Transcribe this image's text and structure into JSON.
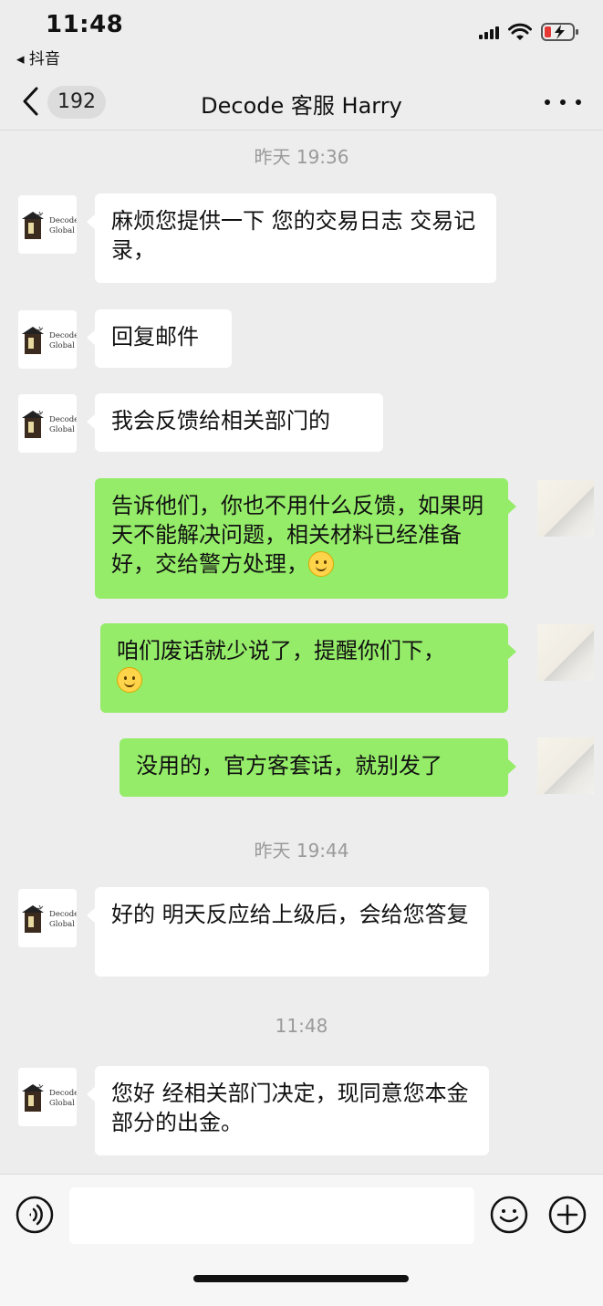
{
  "status_bar": {
    "time": "11:48",
    "back_app": "◂ 抖音"
  },
  "header": {
    "unread_count": "192",
    "title": "Decode 客服 Harry"
  },
  "avatar_text": {
    "line1": "Decode",
    "line2": "Global"
  },
  "chat": {
    "ts1": "昨天 19:36",
    "m1": "麻烦您提供一下 您的交易日志 交易记录，",
    "m2": "回复邮件",
    "m3": "我会反馈给相关部门的",
    "m4": "告诉他们，你也不用什么反馈，如果明天不能解决问题，相关材料已经准备好，交给警方处理，",
    "m5": "咱们废话就少说了，提醒你们下，",
    "m6": "没用的，官方客套话，就别发了",
    "ts2": "昨天 19:44",
    "m7": "好的 明天反应给上级后，会给您答复",
    "ts3": "11:48",
    "m8": "您好 经相关部门决定，现同意您本金部分的出金。"
  },
  "input_bar": {
    "value": ""
  },
  "colors": {
    "background": "#ededed",
    "incoming_bubble": "#ffffff",
    "outgoing_bubble": "#95ec69"
  },
  "icons": {
    "back": "chevron-left-icon",
    "more": "more-dots-icon",
    "voice": "voice-icon",
    "emoji": "emoji-icon",
    "plus": "plus-icon",
    "smiley": "smile-emoji-icon"
  }
}
